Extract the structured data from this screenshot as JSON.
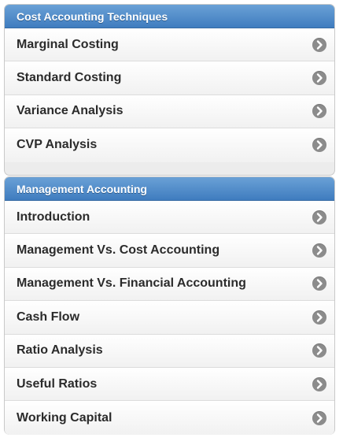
{
  "sections": [
    {
      "title": "Cost Accounting Techniques",
      "items": [
        "Marginal Costing",
        "Standard Costing",
        "Variance Analysis",
        "CVP Analysis"
      ]
    },
    {
      "title": "Management Accounting",
      "items": [
        "Introduction",
        "Management Vs. Cost Accounting",
        "Management Vs. Financial Accounting",
        "Cash Flow",
        "Ratio Analysis",
        "Useful Ratios",
        "Working Capital"
      ]
    }
  ],
  "icon": "chevron-right-circle-icon",
  "colors": {
    "header_top": "#6aa1d6",
    "header_bottom": "#3f7cbf",
    "arrow": "#8c8c8c",
    "text": "#2b2b2b"
  }
}
